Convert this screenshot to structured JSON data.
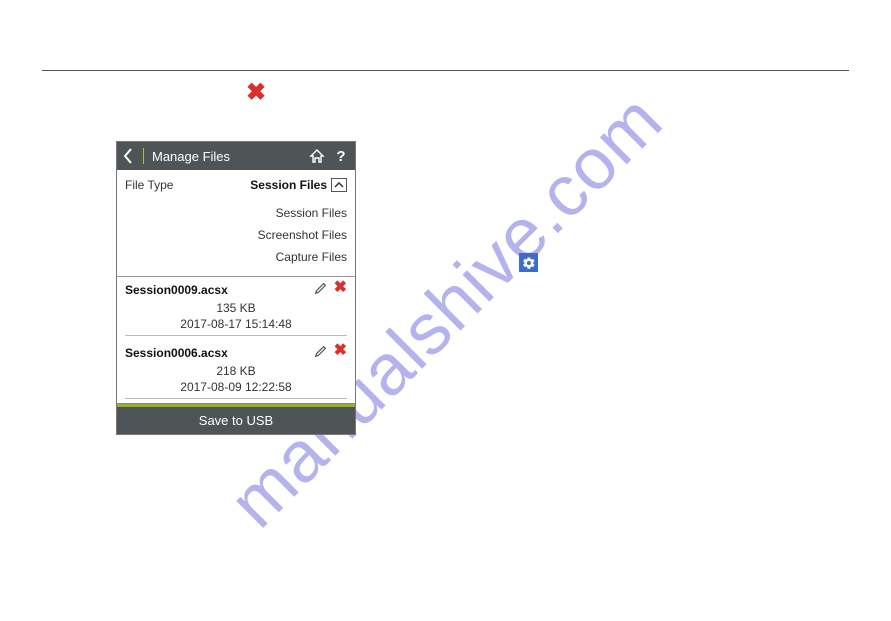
{
  "watermark": "manualshive.com",
  "panel": {
    "title": "Manage Files",
    "filetype_label": "File Type",
    "filetype_value": "Session Files",
    "options": [
      "Session Files",
      "Screenshot Files",
      "Capture Files"
    ],
    "files": [
      {
        "name": "Session0009.acsx",
        "size": "135 KB",
        "date": "2017-08-17 15:14:48"
      },
      {
        "name": "Session0006.acsx",
        "size": "218 KB",
        "date": "2017-08-09 12:22:58"
      }
    ],
    "save_label": "Save to USB"
  }
}
